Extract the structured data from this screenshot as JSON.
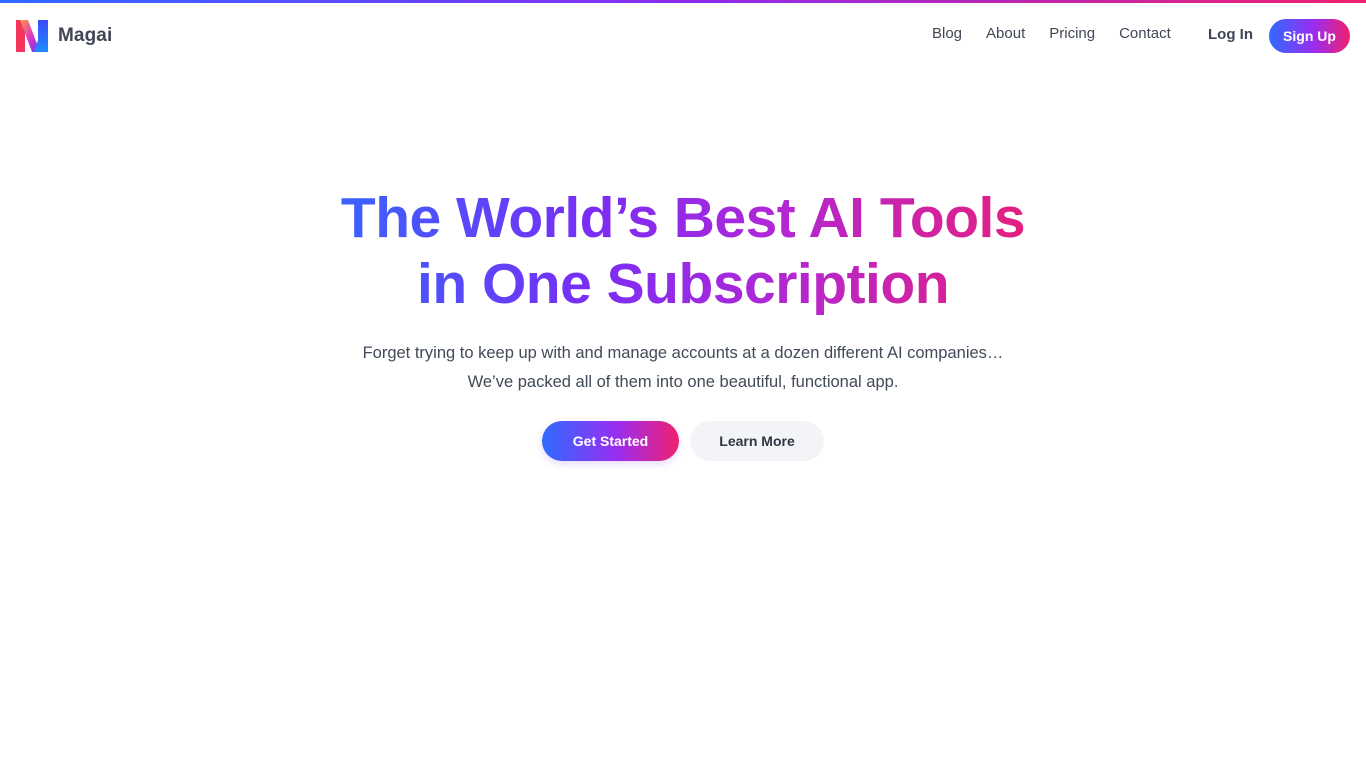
{
  "brand": {
    "name": "Magai",
    "logo_icon": "magai-logo-icon"
  },
  "colors": {
    "gradient_start": "#2f6bff",
    "gradient_mid": "#9a2df0",
    "gradient_end": "#f0206e",
    "text_primary": "#3f4654",
    "secondary_button_bg": "#f3f4f7"
  },
  "nav": {
    "links": [
      {
        "label": "Blog"
      },
      {
        "label": "About"
      },
      {
        "label": "Pricing"
      },
      {
        "label": "Contact"
      }
    ],
    "login_label": "Log In",
    "signup_label": "Sign Up"
  },
  "hero": {
    "title_line1": "The World’s Best AI Tools",
    "title_line2": "in One Subscription",
    "subtitle_line1": "Forget trying to keep up with and manage accounts at a dozen different AI companies…",
    "subtitle_line2": "We’ve packed all of them into one beautiful, functional app.",
    "primary_cta": "Get Started",
    "secondary_cta": "Learn More"
  }
}
